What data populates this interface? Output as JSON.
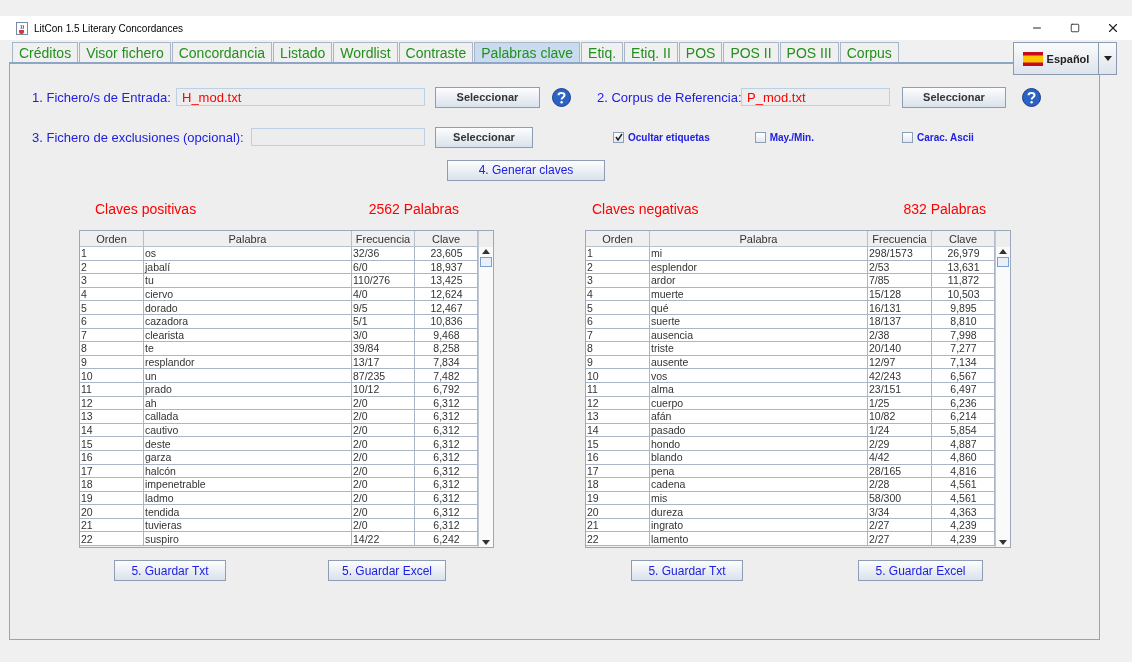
{
  "window": {
    "title": "LitCon 1.5 Literary Concordances"
  },
  "tabs": [
    {
      "label": "Créditos",
      "selected": false
    },
    {
      "label": "Visor fichero",
      "selected": false
    },
    {
      "label": "Concordancia",
      "selected": false
    },
    {
      "label": "Listado",
      "selected": false
    },
    {
      "label": "Wordlist",
      "selected": false
    },
    {
      "label": "Contraste",
      "selected": false
    },
    {
      "label": "Palabras clave",
      "selected": true
    },
    {
      "label": "Etiq.",
      "selected": false
    },
    {
      "label": "Etiq. II",
      "selected": false
    },
    {
      "label": "POS",
      "selected": false
    },
    {
      "label": "POS II",
      "selected": false
    },
    {
      "label": "POS III",
      "selected": false
    },
    {
      "label": "Corpus",
      "selected": false
    }
  ],
  "language": {
    "label": "Español"
  },
  "inputs": [
    {
      "label": "1. Fichero/s de Entrada:",
      "value": "H_mod.txt",
      "button": "Seleccionar",
      "help": true
    },
    {
      "label": "2. Corpus de Referencia:",
      "value": "P_mod.txt",
      "button": "Seleccionar",
      "help": true
    },
    {
      "label": "3. Fichero de exclusiones (opcional):",
      "button": "Seleccionar",
      "help": false
    }
  ],
  "options": [
    {
      "label": "Ocultar etiquetas",
      "checked": true
    },
    {
      "label": "May./Min.",
      "checked": false
    },
    {
      "label": "Carac. Ascii",
      "checked": false
    }
  ],
  "generate_button": "4. Generar claves",
  "results": [
    {
      "title": "Claves positivas",
      "count": "2562 Palabras",
      "columns": [
        "Orden",
        "Palabra",
        "Frecuencia",
        "Clave"
      ],
      "rows": [
        [
          "1",
          "os",
          "32/36",
          "23,605"
        ],
        [
          "2",
          "jabalí",
          "6/0",
          "18,937"
        ],
        [
          "3",
          "tu",
          "110/276",
          "13,425"
        ],
        [
          "4",
          "ciervo",
          "4/0",
          "12,624"
        ],
        [
          "5",
          "dorado",
          "9/5",
          "12,467"
        ],
        [
          "6",
          "cazadora",
          "5/1",
          "10,836"
        ],
        [
          "7",
          "clearista",
          "3/0",
          "9,468"
        ],
        [
          "8",
          "te",
          "39/84",
          "8,258"
        ],
        [
          "9",
          "resplandor",
          "13/17",
          "7,834"
        ],
        [
          "10",
          "un",
          "87/235",
          "7,482"
        ],
        [
          "11",
          "prado",
          "10/12",
          "6,792"
        ],
        [
          "12",
          "ah",
          "2/0",
          "6,312"
        ],
        [
          "13",
          "callada",
          "2/0",
          "6,312"
        ],
        [
          "14",
          "cautivo",
          "2/0",
          "6,312"
        ],
        [
          "15",
          "deste",
          "2/0",
          "6,312"
        ],
        [
          "16",
          "garza",
          "2/0",
          "6,312"
        ],
        [
          "17",
          "halcón",
          "2/0",
          "6,312"
        ],
        [
          "18",
          "impenetrable",
          "2/0",
          "6,312"
        ],
        [
          "19",
          "ladmo",
          "2/0",
          "6,312"
        ],
        [
          "20",
          "tendida",
          "2/0",
          "6,312"
        ],
        [
          "21",
          "tuvieras",
          "2/0",
          "6,312"
        ],
        [
          "22",
          "suspiro",
          "14/22",
          "6,242"
        ]
      ],
      "buttons": [
        "5. Guardar Txt",
        "5. Guardar Excel"
      ]
    },
    {
      "title": "Claves negativas",
      "count": "832 Palabras",
      "columns": [
        "Orden",
        "Palabra",
        "Frecuencia",
        "Clave"
      ],
      "rows": [
        [
          "1",
          "mi",
          "298/1573",
          "26,979"
        ],
        [
          "2",
          "esplendor",
          "2/53",
          "13,631"
        ],
        [
          "3",
          "ardor",
          "7/85",
          "11,872"
        ],
        [
          "4",
          "muerte",
          "15/128",
          "10,503"
        ],
        [
          "5",
          "qué",
          "16/131",
          "9,895"
        ],
        [
          "6",
          "suerte",
          "18/137",
          "8,810"
        ],
        [
          "7",
          "ausencia",
          "2/38",
          "7,998"
        ],
        [
          "8",
          "triste",
          "20/140",
          "7,277"
        ],
        [
          "9",
          "ausente",
          "12/97",
          "7,134"
        ],
        [
          "10",
          "vos",
          "42/243",
          "6,567"
        ],
        [
          "11",
          "alma",
          "23/151",
          "6,497"
        ],
        [
          "12",
          "cuerpo",
          "1/25",
          "6,236"
        ],
        [
          "13",
          "afán",
          "10/82",
          "6,214"
        ],
        [
          "14",
          "pasado",
          "1/24",
          "5,854"
        ],
        [
          "15",
          "hondo",
          "2/29",
          "4,887"
        ],
        [
          "16",
          "blando",
          "4/42",
          "4,860"
        ],
        [
          "17",
          "pena",
          "28/165",
          "4,816"
        ],
        [
          "18",
          "cadena",
          "2/28",
          "4,561"
        ],
        [
          "19",
          "mis",
          "58/300",
          "4,561"
        ],
        [
          "20",
          "dureza",
          "3/34",
          "4,363"
        ],
        [
          "21",
          "ingrato",
          "2/27",
          "4,239"
        ],
        [
          "22",
          "lamento",
          "2/27",
          "4,239"
        ]
      ],
      "buttons": [
        "5. Guardar Txt",
        "5. Guardar Excel"
      ]
    }
  ]
}
